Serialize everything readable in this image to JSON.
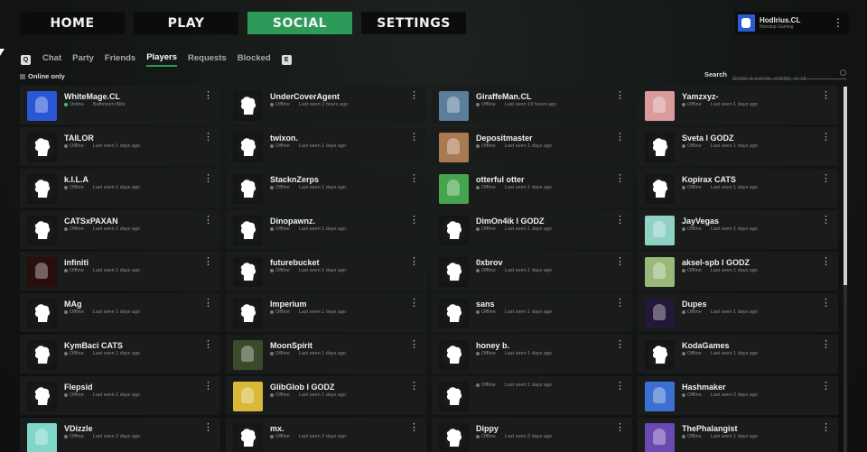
{
  "nav": {
    "home": "HOME",
    "play": "PLAY",
    "social": "SOCIAL",
    "settings": "SETTINGS"
  },
  "profile": {
    "name": "Hodlrius.CL",
    "subtitle": "Nonstop Gaming"
  },
  "subtabs": {
    "left_key": "Q",
    "right_key": "E",
    "items": [
      "Chat",
      "Party",
      "Friends",
      "Players",
      "Requests",
      "Blocked"
    ],
    "active": "Players"
  },
  "filter": {
    "online_only": "Online only"
  },
  "search": {
    "label": "Search",
    "placeholder": "Enter a name, wallet, or id"
  },
  "colors": {
    "accent": "#2e9a5a",
    "online": "#3fc46a"
  },
  "players": [
    {
      "name": "WhiteMage.CL",
      "state": "Online",
      "detail": "Bathroom Blitz",
      "avatar": "#2b57d6",
      "blank": false
    },
    {
      "name": "UnderCoverAgent",
      "state": "Offline",
      "detail": "Last seen 2 hours ago",
      "blank": true
    },
    {
      "name": "GiraffeMan.CL",
      "state": "Offline",
      "detail": "Last seen 19 hours ago",
      "avatar": "#5a7f9a",
      "blank": false
    },
    {
      "name": "Yamzxyz-",
      "state": "Offline",
      "detail": "Last seen 1 days ago",
      "avatar": "#d99b9b",
      "blank": false
    },
    {
      "name": "TAILOR",
      "state": "Offline",
      "detail": "Last seen 1 days ago",
      "blank": true
    },
    {
      "name": "twixon.",
      "state": "Offline",
      "detail": "Last seen 1 days ago",
      "blank": true
    },
    {
      "name": "Depositmaster",
      "state": "Offline",
      "detail": "Last seen 1 days ago",
      "avatar": "#a97a52",
      "blank": false
    },
    {
      "name": "Sveta l GODZ",
      "state": "Offline",
      "detail": "Last seen 1 days ago",
      "blank": true
    },
    {
      "name": "k.I.L.A",
      "state": "Offline",
      "detail": "Last seen 1 days ago",
      "blank": true
    },
    {
      "name": "StacknZerps",
      "state": "Offline",
      "detail": "Last seen 1 days ago",
      "blank": true
    },
    {
      "name": "otterful otter",
      "state": "Offline",
      "detail": "Last seen 1 days ago",
      "avatar": "#46a34e",
      "blank": false
    },
    {
      "name": "Kopirax CATS",
      "state": "Offline",
      "detail": "Last seen 1 days ago",
      "blank": true
    },
    {
      "name": "CATSxPAXAN",
      "state": "Offline",
      "detail": "Last seen 1 days ago",
      "blank": true
    },
    {
      "name": "Dinopawnz.",
      "state": "Offline",
      "detail": "Last seen 1 days ago",
      "blank": true
    },
    {
      "name": "DimOn4ik l GODZ",
      "state": "Offline",
      "detail": "Last seen 1 days ago",
      "blank": true
    },
    {
      "name": "JayVegas",
      "state": "Offline",
      "detail": "Last seen 1 days ago",
      "avatar": "#8fd1c3",
      "blank": false
    },
    {
      "name": "infiniti",
      "state": "Offline",
      "detail": "Last seen 1 days ago",
      "avatar": "#2a0d0d",
      "blank": false
    },
    {
      "name": "futurebucket",
      "state": "Offline",
      "detail": "Last seen 1 days ago",
      "blank": true
    },
    {
      "name": "0xbrov",
      "state": "Offline",
      "detail": "Last seen 1 days ago",
      "blank": true
    },
    {
      "name": "aksel-spb l GODZ",
      "state": "Offline",
      "detail": "Last seen 1 days ago",
      "avatar": "#9ab87a",
      "blank": false
    },
    {
      "name": "MAg",
      "state": "Offline",
      "detail": "Last seen 1 days ago",
      "blank": true
    },
    {
      "name": "Imperium",
      "state": "Offline",
      "detail": "Last seen 1 days ago",
      "blank": true
    },
    {
      "name": "sans",
      "state": "Offline",
      "detail": "Last seen 1 days ago",
      "blank": true
    },
    {
      "name": "Dupes",
      "state": "Offline",
      "detail": "Last seen 1 days ago",
      "avatar": "#24183a",
      "blank": false
    },
    {
      "name": "KymBaci CATS",
      "state": "Offline",
      "detail": "Last seen 1 days ago",
      "blank": true
    },
    {
      "name": "MoonSpirit",
      "state": "Offline",
      "detail": "Last seen 1 days ago",
      "avatar": "#3a4a2a",
      "blank": false
    },
    {
      "name": "honey b.",
      "state": "Offline",
      "detail": "Last seen 1 days ago",
      "blank": true
    },
    {
      "name": "KodaGames",
      "state": "Offline",
      "detail": "Last seen 1 days ago",
      "blank": true
    },
    {
      "name": "Flepsid",
      "state": "Offline",
      "detail": "Last seen 1 days ago",
      "blank": true
    },
    {
      "name": "GlibGlob l GODZ",
      "state": "Offline",
      "detail": "Last seen 1 days ago",
      "avatar": "#d9b93a",
      "blank": false
    },
    {
      "name": "",
      "state": "Offline",
      "detail": "Last seen 1 days ago",
      "blank": true
    },
    {
      "name": "Hashmaker",
      "state": "Offline",
      "detail": "Last seen 2 days ago",
      "avatar": "#3b6fd1",
      "blank": false
    },
    {
      "name": "VDizzle",
      "state": "Offline",
      "detail": "Last seen 2 days ago",
      "avatar": "#7fd6c9",
      "blank": false
    },
    {
      "name": "mx.",
      "state": "Offline",
      "detail": "Last seen 2 days ago",
      "blank": true
    },
    {
      "name": "Dippy",
      "state": "Offline",
      "detail": "Last seen 2 days ago",
      "blank": true
    },
    {
      "name": "ThePhalangist",
      "state": "Offline",
      "detail": "Last seen 1 days ago",
      "avatar": "#6a4ab0",
      "blank": false
    }
  ]
}
